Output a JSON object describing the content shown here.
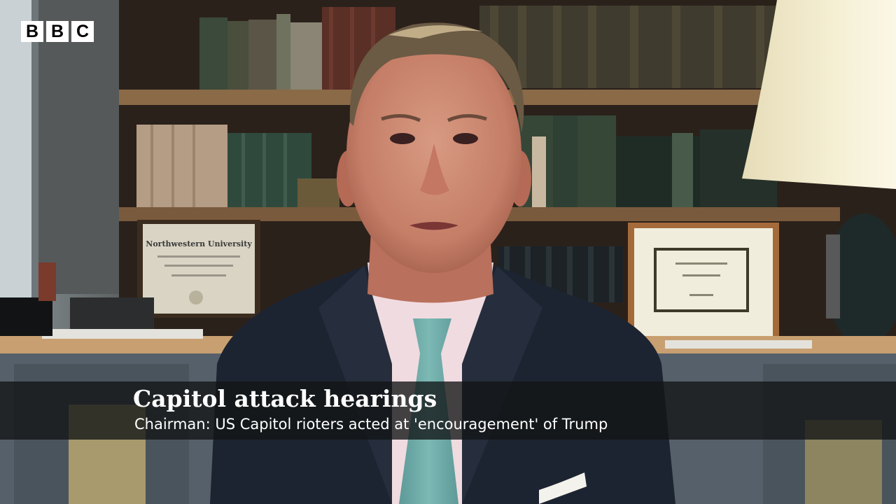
{
  "logo": {
    "letters": [
      "B",
      "B",
      "C"
    ]
  },
  "caption": {
    "headline": "Capitol attack hearings",
    "subline": "Chairman: US Capitol rioters acted at  'encouragement' of Trump"
  },
  "certificate": {
    "institution": "Northwestern University"
  },
  "colors": {
    "caption_bg": "#121416",
    "caption_text": "#ffffff",
    "logo_bg": "#ffffff",
    "logo_text": "#000000"
  }
}
